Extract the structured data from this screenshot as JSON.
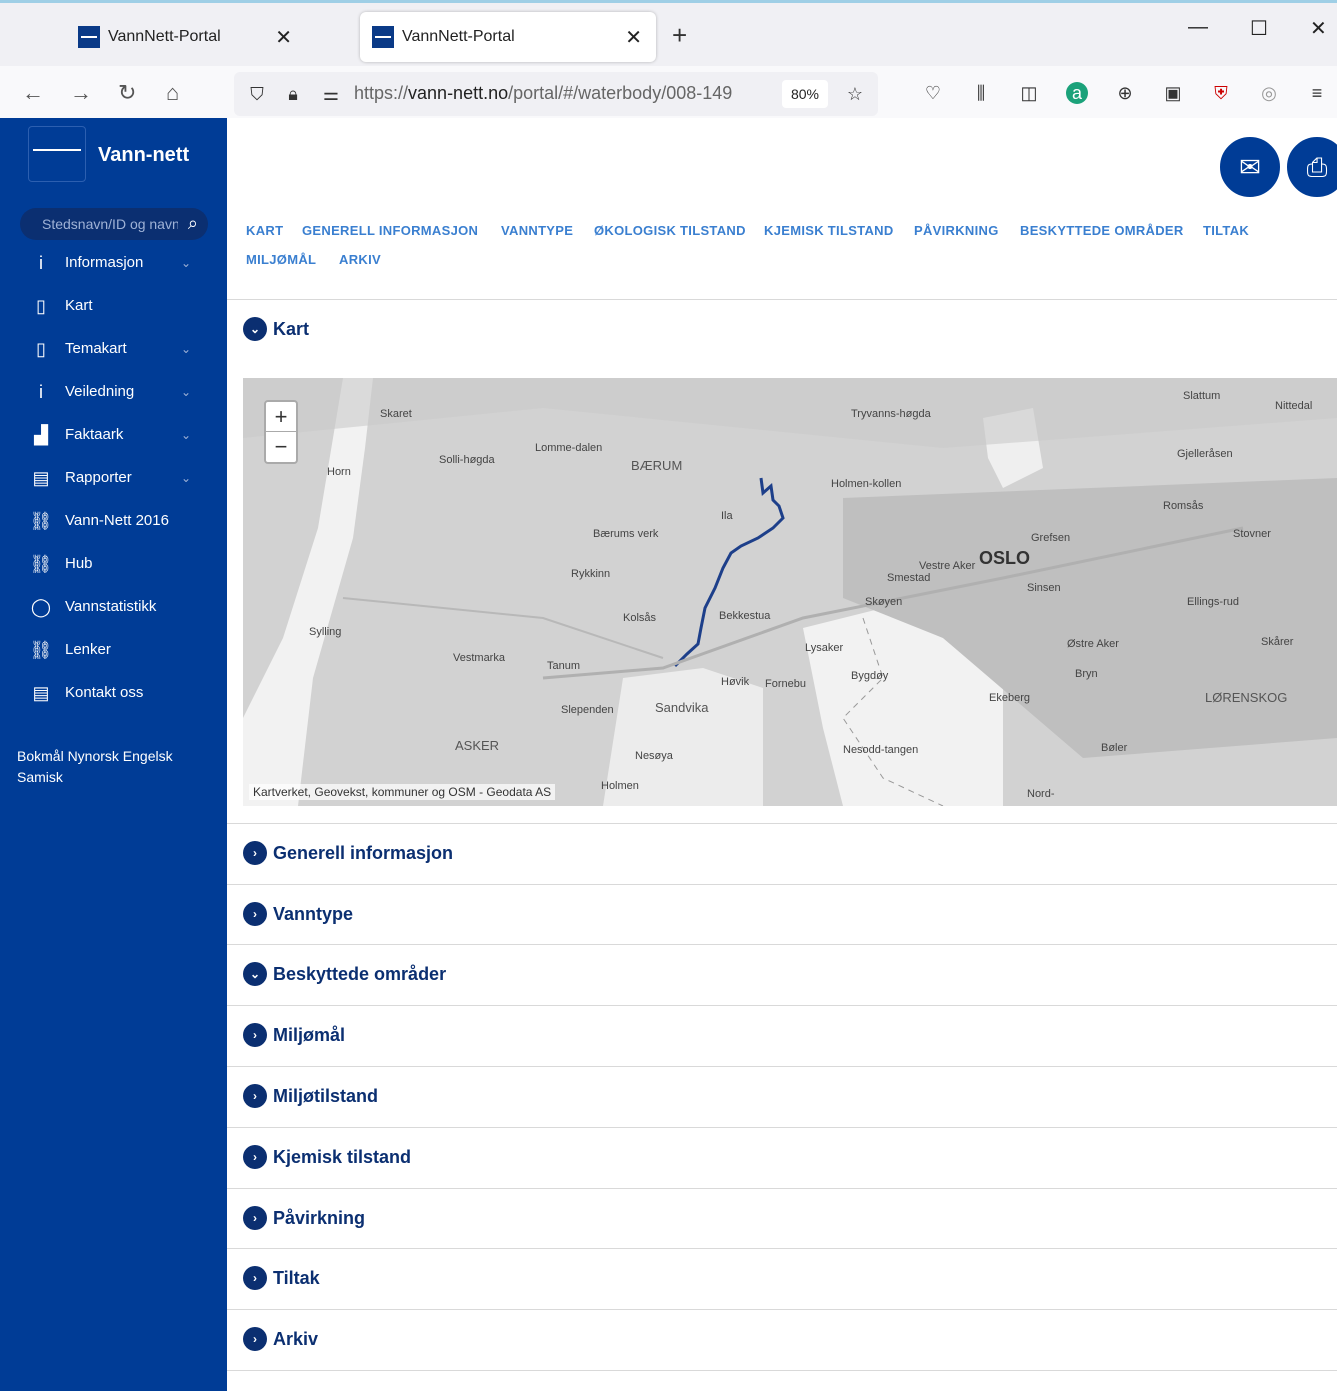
{
  "browser": {
    "tabs": [
      {
        "label": "VannNett-Portal"
      },
      {
        "label": "VannNett-Portal"
      }
    ],
    "new_tab": "+",
    "url_prefix": "https://",
    "url_domain": "vann-nett.no",
    "url_rest": "/portal/#/waterbody/008-149",
    "zoom": "80%"
  },
  "sidebar": {
    "brand": "Vann-nett",
    "search_placeholder": "Stedsnavn/ID og navn",
    "items": [
      {
        "label": "Informasjon",
        "icon": "info-icon",
        "glyph": "i",
        "has_chevron": true
      },
      {
        "label": "Kart",
        "icon": "map-icon",
        "glyph": "▯",
        "has_chevron": false
      },
      {
        "label": "Temakart",
        "icon": "map-icon",
        "glyph": "▯",
        "has_chevron": true
      },
      {
        "label": "Veiledning",
        "icon": "info-icon",
        "glyph": "i",
        "has_chevron": true
      },
      {
        "label": "Faktaark",
        "icon": "chart-icon",
        "glyph": "▟",
        "has_chevron": true
      },
      {
        "label": "Rapporter",
        "icon": "document-icon",
        "glyph": "▤",
        "has_chevron": true
      },
      {
        "label": "Vann-Nett 2016",
        "icon": "link-icon",
        "glyph": "⛓",
        "has_chevron": false
      },
      {
        "label": "Hub",
        "icon": "link-icon",
        "glyph": "⛓",
        "has_chevron": false
      },
      {
        "label": "Vannstatistikk",
        "icon": "circle-icon",
        "glyph": "◯",
        "has_chevron": false
      },
      {
        "label": "Lenker",
        "icon": "link-icon",
        "glyph": "⛓",
        "has_chevron": false
      },
      {
        "label": "Kontakt oss",
        "icon": "document-icon",
        "glyph": "▤",
        "has_chevron": false
      }
    ],
    "languages": "Bokmål Nynorsk Engelsk Samisk"
  },
  "subnav": [
    "KART",
    "GENERELL INFORMASJON",
    "VANNTYPE",
    "ØKOLOGISK TILSTAND",
    "KJEMISK TILSTAND",
    "PÅVIRKNING",
    "BESKYTTEDE OMRÅDER",
    "TILTAK",
    "MILJØMÅL",
    "ARKIV"
  ],
  "sections": [
    {
      "title": "Kart",
      "expanded": true
    },
    {
      "title": "Generell informasjon",
      "expanded": false
    },
    {
      "title": "Vanntype",
      "expanded": false
    },
    {
      "title": "Beskyttede områder",
      "expanded": true
    },
    {
      "title": "Miljømål",
      "expanded": false
    },
    {
      "title": "Miljøtilstand",
      "expanded": false
    },
    {
      "title": "Kjemisk tilstand",
      "expanded": false
    },
    {
      "title": "Påvirkning",
      "expanded": false
    },
    {
      "title": "Tiltak",
      "expanded": false
    },
    {
      "title": "Arkiv",
      "expanded": false
    }
  ],
  "map": {
    "zoom_in": "+",
    "zoom_out": "−",
    "attribution": "Kartverket, Geovekst, kommuner og OSM - Geodata AS",
    "labels": [
      "Skaret",
      "Lomme-dalen",
      "BÆRUM",
      "Tryvanns-høgda",
      "Holmen-kollen",
      "Horn",
      "Solli-høgda",
      "Ila",
      "Bærums verk",
      "Rykkinn",
      "OSLO",
      "Vestre Aker",
      "Grefsen",
      "Smestad",
      "Skøyen",
      "Sinsen",
      "Kolsås",
      "Bekkestua",
      "Sylling",
      "Vestmarka",
      "Tanum",
      "Lysaker",
      "Bygdøy",
      "Sandvika",
      "Høvik",
      "Fornebu",
      "Slependen",
      "Nesodd-tangen",
      "ASKER",
      "Nesøya",
      "Ekeberg",
      "Bryn",
      "Østre Aker",
      "Bøler",
      "Ellings-rud",
      "Stovner",
      "Romsås",
      "Gjelleråsen",
      "Slattum",
      "Nittedal",
      "LØRENSKOG",
      "Skårer",
      "Holmen",
      "Nord-"
    ]
  }
}
